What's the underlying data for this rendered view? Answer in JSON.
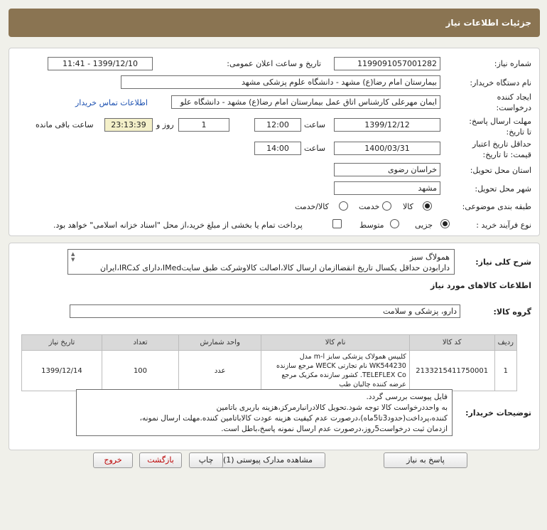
{
  "header": {
    "title": "جزئیات اطلاعات نیاز"
  },
  "details": {
    "need_number_label": "شماره نیاز:",
    "need_number": "1199091057001282",
    "announce_label": "تاریخ و ساعت اعلان عمومی:",
    "announce_value": "1399/12/10 - 11:41",
    "buyer_org_label": "نام دستگاه خریدار:",
    "buyer_org": "بیمارستان امام رضا(ع) مشهد - دانشگاه علوم پزشکی مشهد",
    "creator_label_1": "ایجاد کننده",
    "creator_label_2": "درخواست:",
    "creator": "ایمان مهرعلی کارشناس اتاق عمل بیمارستان امام رضا(ع) مشهد - دانشگاه علو",
    "contact_link": "اطلاعات تماس خریدار",
    "reply_deadline_label_1": "مهلت ارسال پاسخ:",
    "reply_deadline_label_2": "تا تاریخ:",
    "reply_date": "1399/12/12",
    "time_label": "ساعت",
    "reply_time": "12:00",
    "days_value": "1",
    "days_label": "روز و",
    "remaining_time": "23:13:39",
    "remaining_label": "ساعت باقی مانده",
    "price_validity_label_1": "حداقل تاریخ اعتبار",
    "price_validity_label_2": "قیمت: تا تاریخ:",
    "price_date": "1400/03/31",
    "price_time_label": "ساعت",
    "price_time": "14:00",
    "province_label": "استان محل تحویل:",
    "province": "خراسان رضوی",
    "city_label": "شهر محل تحویل:",
    "city": "مشهد",
    "category_label": "طبقه بندی موضوعی:",
    "category_options": [
      "کالا",
      "خدمت",
      "کالا/خدمت"
    ],
    "category_selected": "کالا",
    "process_label": "نوع فرآیند خرید :",
    "process_options": [
      "جزیی",
      "متوسط"
    ],
    "process_selected": "جزیی",
    "treasury_note": "پرداخت تمام یا بخشی از مبلغ خرید،از محل \"اسناد خزانه اسلامی\" خواهد بود."
  },
  "summary": {
    "label": "شرح کلی نیاز:",
    "line1": "همولاگ سبز",
    "line2": "دارابودن حداقل یکسال تاریخ انقضاازمان ارسال کالا،اصالت کالاوشرکت طبق سایتIMed،دارای کدIRC،ایران"
  },
  "goods": {
    "section_title": "اطلاعات کالاهای مورد نیاز",
    "group_label": "گروه کالا:",
    "group_value": "دارو، پزشکی و سلامت",
    "columns": [
      "ردیف",
      "کد کالا",
      "نام کالا",
      "واحد شمارش",
      "تعداد",
      "تاریخ نیاز"
    ],
    "rows": [
      {
        "row": "1",
        "code": "2133215411750001",
        "name": "کلیپس همولاک پزشکی سایز m-l مدل WK544230 نام تجارتی WECK مرجع سازنده TELEFLEX Co. کشور سازنده مکزیک مرجع عرضه کننده چالیان طب",
        "unit": "عدد",
        "qty": "100",
        "date": "1399/12/14"
      }
    ]
  },
  "buyer_notes": {
    "label": "توضیحات خریدار:",
    "lines": [
      "فایل پیوست بررسی گردد.",
      "به واحددرخواست کالا توجه شود.تحویل کالادرانبارمرکز،هزینه باربری باتامین",
      "کننده،پرداخت(حدود3تا5ماه)،درصورت عدم کیفیت هزینه عودت کالاباتامین کننده.مهلت ارسال نمونه،",
      "ازدمان ثبت درخواست5روز،درصورت عدم ارسال نمونه پاسخ،باطل است."
    ]
  },
  "buttons": {
    "reply": "پاسخ به نیاز",
    "attachments": "مشاهده مدارک پیوستی (1)",
    "print": "چاپ",
    "back": "بازگشت",
    "exit": "خروج"
  }
}
